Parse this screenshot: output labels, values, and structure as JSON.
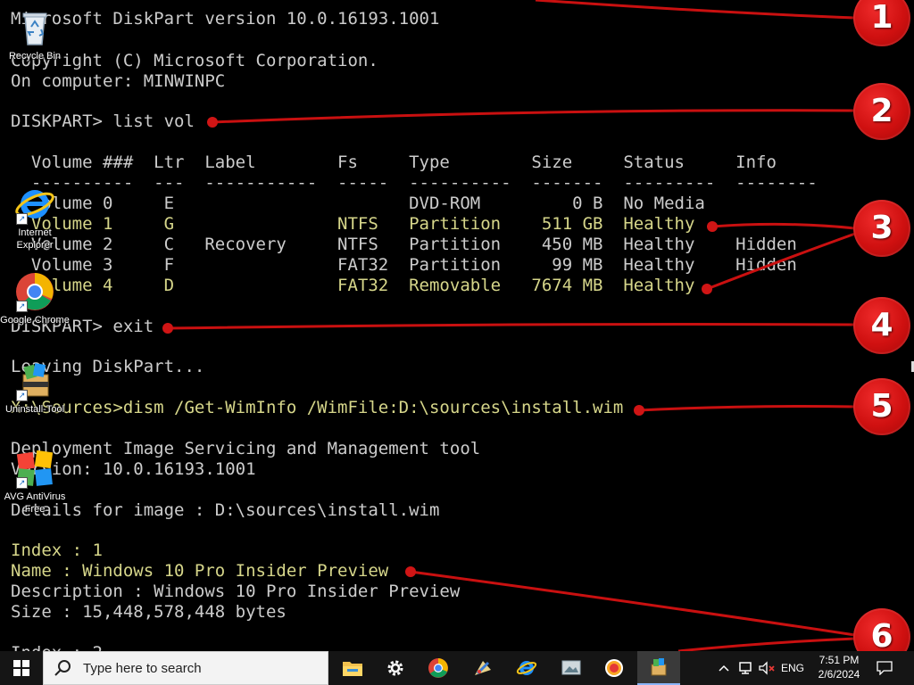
{
  "console": {
    "lines": [
      {
        "text": "Microsoft DiskPart version 10.0.16193.1001"
      },
      {
        "text": "Copyright (C) Microsoft Corporation."
      },
      {
        "text": "On computer: MINWINPC"
      },
      {
        "text": "DISKPART> list vol"
      },
      {
        "text": "  Volume ###  Ltr  Label        Fs     Type        Size     Status     Info"
      },
      {
        "text": "  ----------  ---  -----------  -----  ----------  -------  ---------  --------"
      },
      {
        "text": "  Volume 0     E                       DVD-ROM         0 B  No Media"
      },
      {
        "text": "  Volume 1     G                NTFS   Partition    511 GB  Healthy"
      },
      {
        "text": "  Volume 2     C   Recovery     NTFS   Partition    450 MB  Healthy    Hidden"
      },
      {
        "text": "  Volume 3     F                FAT32  Partition     99 MB  Healthy    Hidden"
      },
      {
        "text": "  Volume 4     D                FAT32  Removable   7674 MB  Healthy"
      },
      {
        "text": "DISKPART> exit"
      },
      {
        "text": "Leaving DiskPart..."
      },
      {
        "text": "X:\\Sources>dism /Get-WimInfo /WimFile:D:\\sources\\install.wim"
      },
      {
        "text": "Deployment Image Servicing and Management tool"
      },
      {
        "text": "Version: 10.0.16193.1001"
      },
      {
        "text": "Details for image : D:\\sources\\install.wim"
      },
      {
        "text": "Index : 1"
      },
      {
        "text": "Name : Windows 10 Pro Insider Preview"
      },
      {
        "text": "Description : Windows 10 Pro Insider Preview"
      },
      {
        "text": "Size : 15,448,578,448 bytes"
      },
      {
        "text": "Index : 2"
      }
    ],
    "highlight_color": "#d6d68a",
    "text_color": "#cccccc",
    "background": "#000000"
  },
  "desktop_icons": [
    {
      "label": "Recycle Bin",
      "icon": "recycle-bin-icon"
    },
    {
      "label": "Internet Explorer",
      "icon": "internet-explorer-icon"
    },
    {
      "label": "Google Chrome",
      "icon": "chrome-icon"
    },
    {
      "label": "Uninstall-Tool",
      "icon": "uninstall-tool-icon"
    },
    {
      "label": "AVG AntiVirus Free",
      "icon": "avg-antivirus-icon"
    }
  ],
  "annotations": {
    "badges": [
      "1",
      "2",
      "3",
      "4",
      "5",
      "6"
    ],
    "color": "#d01515"
  },
  "taskbar": {
    "search_placeholder": "Type here to search",
    "apps": [
      "file-explorer-icon",
      "settings-icon",
      "chrome-icon",
      "paint-icon",
      "internet-explorer-icon",
      "photo-viewer-icon",
      "security-icon",
      "uninstall-tool-icon"
    ],
    "tray": {
      "language": "ENG",
      "time": "7:51 PM",
      "date": "2/6/2024"
    }
  }
}
